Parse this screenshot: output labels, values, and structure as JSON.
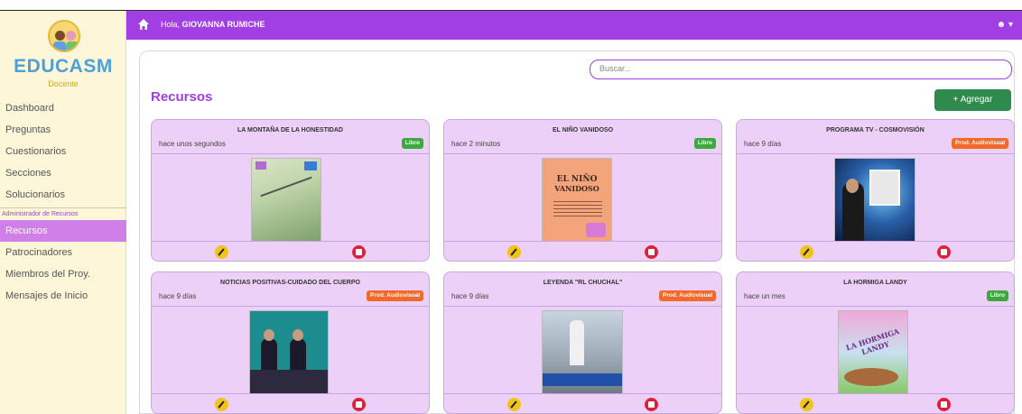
{
  "sidebar": {
    "brand": "EDUCASM",
    "role": "Docente",
    "items": [
      {
        "label": "Dashboard"
      },
      {
        "label": "Preguntas"
      },
      {
        "label": "Cuestionarios"
      },
      {
        "label": "Secciones"
      },
      {
        "label": "Solucionarios"
      }
    ],
    "section_label": "Administrador de Recursos",
    "items2": [
      {
        "label": "Recursos",
        "active": true
      },
      {
        "label": "Patrocinadores"
      },
      {
        "label": "Miembros del Proy."
      },
      {
        "label": "Mensajes de Inicio"
      }
    ]
  },
  "header": {
    "greeting": "Hola,",
    "user_name": "GIOVANNA RUMICHE",
    "user_menu_icon": "user-icon"
  },
  "main": {
    "search_placeholder": "Buscar...",
    "title": "Recursos",
    "add_label": "+ Agregar",
    "cards": [
      {
        "title": "LA MONTAÑA DE LA HONESTIDAD",
        "time": "hace unos segundos",
        "badge": "Libro"
      },
      {
        "title": "EL NIÑO VANIDOSO",
        "time": "hace 2 minutos",
        "badge": "Libro",
        "cover_line1": "EL NIÑO",
        "cover_line2": "VANIDOSO"
      },
      {
        "title": "PROGRAMA TV - COSMOVISIÓN",
        "time": "hace 9 días",
        "badge": "Prod. Audiovisual"
      },
      {
        "title": "NOTICIAS POSITIVAS-CUIDADO DEL CUERPO",
        "time": "hace 9 días",
        "badge": "Prod. Audiovisual"
      },
      {
        "title": "LEYENDA \"RL CHUCHAL\"",
        "time": "hace 9 días",
        "badge": "Prod. Audiovisual"
      },
      {
        "title": "LA HORMIGA LANDY",
        "time": "hace un mes",
        "badge": "Libro",
        "cover_text": "LA HORMIGA LANDY"
      }
    ]
  },
  "colors": {
    "accent": "#a13ee4",
    "sidebar_bg": "#fdf6d8",
    "card_bg": "#ecd0f7",
    "badge_libro": "#3ea83e",
    "badge_audio": "#f26a2b",
    "add_button": "#2e8b4d"
  }
}
